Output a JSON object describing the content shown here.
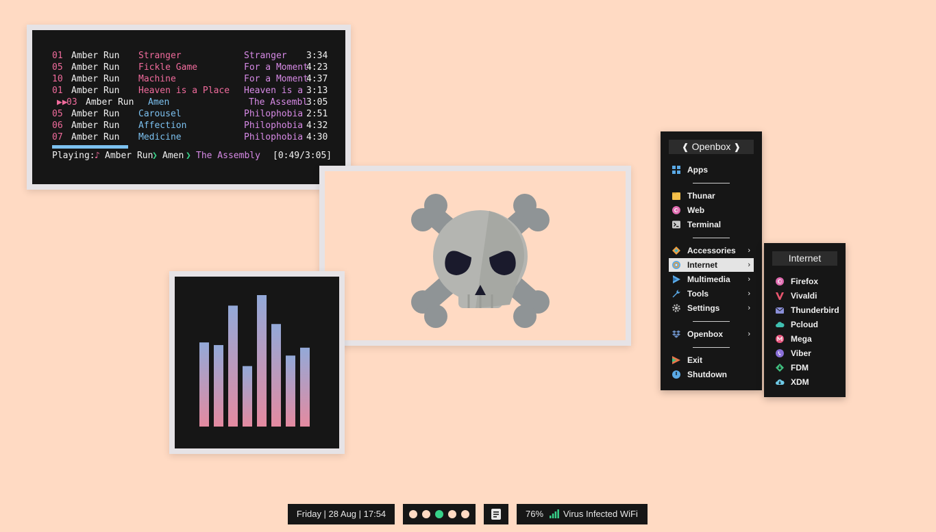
{
  "player": {
    "tracks": [
      {
        "num": "01",
        "artist": "Amber Run",
        "title": "Stranger",
        "album": "Stranger",
        "time": "3:34",
        "playing": false
      },
      {
        "num": "05",
        "artist": "Amber Run",
        "title": "Fickle Game",
        "album": "For a Moment",
        "time": "4:23",
        "playing": false
      },
      {
        "num": "10",
        "artist": "Amber Run",
        "title": "Machine",
        "album": "For a Moment",
        "time": "4:37",
        "playing": false
      },
      {
        "num": "01",
        "artist": "Amber Run",
        "title": "Heaven is a Place",
        "album": "Heaven is a",
        "time": "3:13",
        "playing": false
      },
      {
        "num": "03",
        "artist": "Amber Run",
        "title": "Amen",
        "album": "The Assembl",
        "time": "3:05",
        "playing": true
      },
      {
        "num": "05",
        "artist": "Amber Run",
        "title": "Carousel",
        "album": "Philophobia",
        "time": "2:51",
        "playing": false
      },
      {
        "num": "06",
        "artist": "Amber Run",
        "title": "Affection",
        "album": "Philophobia",
        "time": "4:32",
        "playing": false
      },
      {
        "num": "07",
        "artist": "Amber Run",
        "title": "Medicine",
        "album": "Philophobia",
        "time": "4:30",
        "playing": false
      }
    ],
    "playing_marker": "▶▶",
    "progress_fraction": 0.27,
    "now_playing": {
      "label": "Playing:",
      "note_glyph": "♪",
      "artist": "Amber Run",
      "sep_glyph": "❯",
      "title": "Amen",
      "album": "The Assembly",
      "position": "[0:49/3:05]"
    }
  },
  "visualizer": {
    "levels": [
      0.64,
      0.62,
      0.92,
      0.46,
      1.0,
      0.78,
      0.54,
      0.6
    ],
    "gradient_top": "#93a9d8",
    "gradient_bottom": "#e48aa0"
  },
  "menu": {
    "title": "Openbox",
    "items": [
      {
        "label": "Apps",
        "icon": "apps-grid-icon",
        "has_sub": false
      },
      {
        "label": "Thunar",
        "icon": "folder-icon",
        "has_sub": false
      },
      {
        "label": "Web",
        "icon": "firefox-icon",
        "has_sub": false
      },
      {
        "label": "Terminal",
        "icon": "terminal-icon",
        "has_sub": false
      },
      {
        "label": "Accessories",
        "icon": "accessories-icon",
        "has_sub": true
      },
      {
        "label": "Internet",
        "icon": "internet-icon",
        "has_sub": true
      },
      {
        "label": "Multimedia",
        "icon": "multimedia-icon",
        "has_sub": true
      },
      {
        "label": "Tools",
        "icon": "wrench-icon",
        "has_sub": true
      },
      {
        "label": "Settings",
        "icon": "gear-icon",
        "has_sub": true
      },
      {
        "label": "Openbox",
        "icon": "dropbox-icon",
        "has_sub": true
      },
      {
        "label": "Exit",
        "icon": "exit-icon",
        "has_sub": false
      },
      {
        "label": "Shutdown",
        "icon": "power-icon",
        "has_sub": false
      }
    ],
    "arrow": "›"
  },
  "submenu": {
    "title": "Internet",
    "items": [
      {
        "label": "Firefox",
        "icon": "firefox-icon"
      },
      {
        "label": "Vivaldi",
        "icon": "vivaldi-icon"
      },
      {
        "label": "Thunderbird",
        "icon": "mail-icon"
      },
      {
        "label": "Pcloud",
        "icon": "cloud-icon"
      },
      {
        "label": "Mega",
        "icon": "mega-icon"
      },
      {
        "label": "Viber",
        "icon": "phone-icon"
      },
      {
        "label": "FDM",
        "icon": "download-diamond-icon"
      },
      {
        "label": "XDM",
        "icon": "download-cloud-icon"
      }
    ]
  },
  "bar": {
    "datetime": "Friday | 28 Aug | 17:54",
    "workspaces": [
      {
        "color": "#ffdac3",
        "active": false
      },
      {
        "color": "#ffdac3",
        "active": false
      },
      {
        "color": "#37d28a",
        "active": true
      },
      {
        "color": "#ffdac3",
        "active": false
      },
      {
        "color": "#ffdac3",
        "active": false
      }
    ],
    "notes_icon": "notes-icon",
    "battery": "76%",
    "wifi_name": "Virus Infected WiFi"
  },
  "colors": {
    "desktop_bg": "#ffdac3",
    "panel_bg": "#161616",
    "frame": "#e6e3e6",
    "pink": "#f06b9c",
    "blue": "#7cc1f0",
    "violet": "#d78ae6",
    "green": "#37d28a"
  }
}
